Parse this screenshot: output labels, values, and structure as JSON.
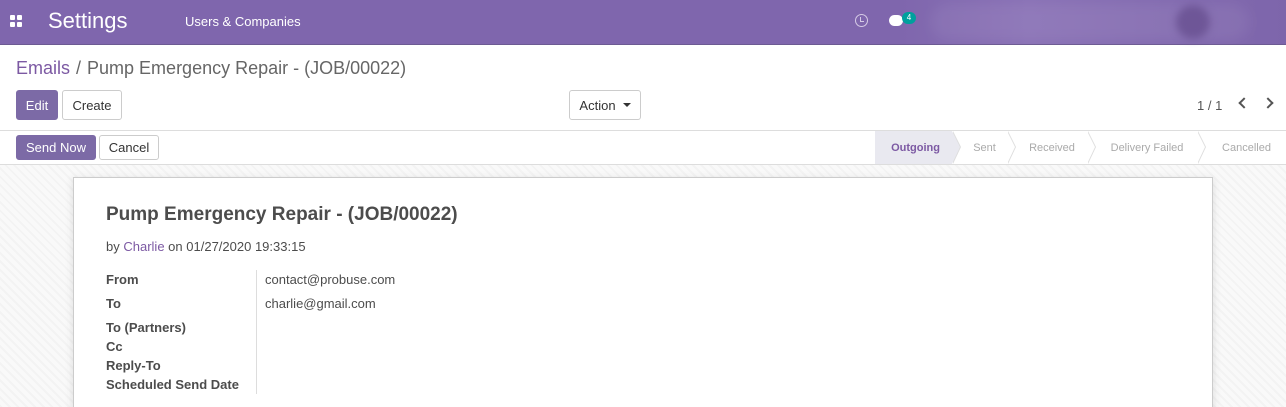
{
  "navbar": {
    "app_name": "Settings",
    "menu_item": "Users & Companies",
    "chat_count": "4",
    "colors": {
      "navbar": "#7f66ad",
      "accent": "#7c59a3",
      "badge": "#00a09d"
    }
  },
  "breadcrumb": {
    "parent": "Emails",
    "separator": "/",
    "current": "Pump Emergency Repair - (JOB/00022)"
  },
  "toolbar": {
    "edit_label": "Edit",
    "create_label": "Create",
    "action_label": "Action",
    "pager": "1 / 1"
  },
  "statusbar": {
    "send_now_label": "Send Now",
    "cancel_label": "Cancel",
    "stages": [
      "Outgoing",
      "Sent",
      "Received",
      "Delivery Failed",
      "Cancelled"
    ],
    "active_stage": "Outgoing"
  },
  "email": {
    "subject": "Pump Emergency Repair - (JOB/00022)",
    "by_prefix": "by",
    "author": "Charlie",
    "on_word": "on",
    "date": "01/27/2020 19:33:15",
    "fields": [
      {
        "label": "From",
        "value": "contact@probuse.com"
      },
      {
        "label": "To",
        "value": "charlie@gmail.com"
      },
      {
        "label": "To (Partners)",
        "value": ""
      },
      {
        "label": "Cc",
        "value": ""
      },
      {
        "label": "Reply-To",
        "value": ""
      },
      {
        "label": "Scheduled Send Date",
        "value": ""
      }
    ]
  }
}
